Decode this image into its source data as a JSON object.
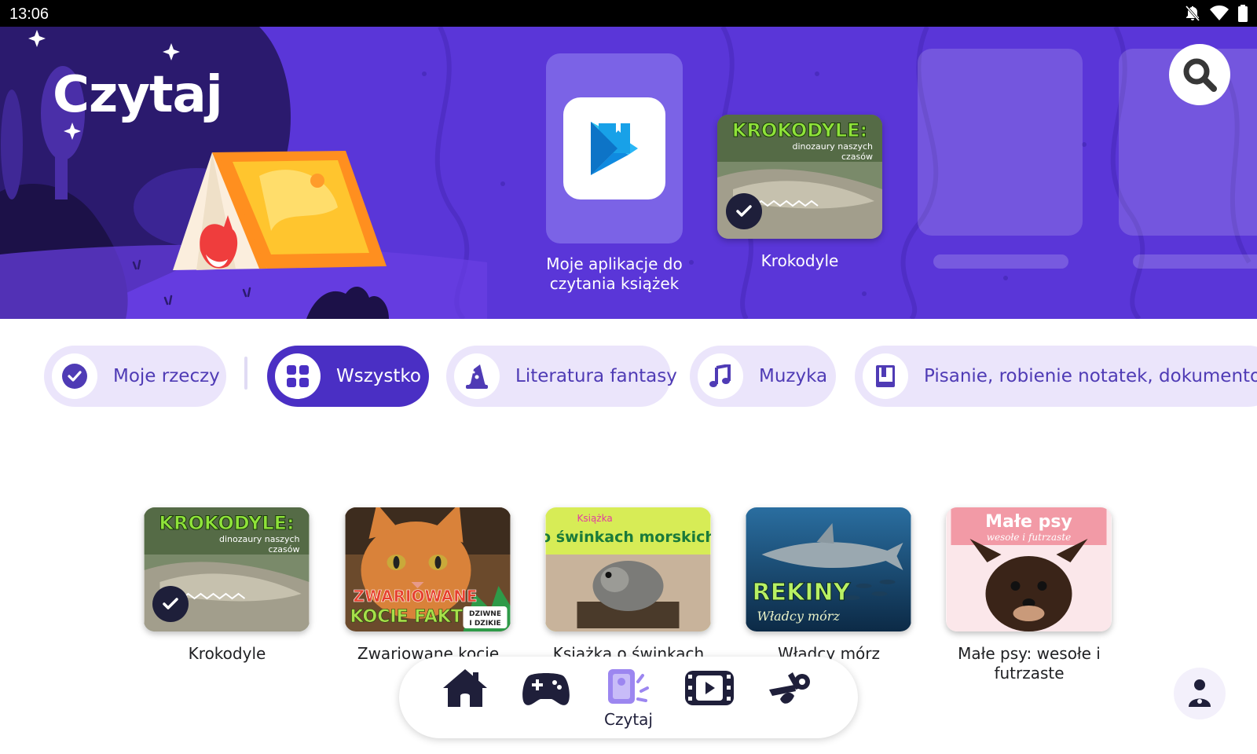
{
  "status_bar": {
    "time": "13:06"
  },
  "header": {
    "title": "Czytaj"
  },
  "featured": [
    {
      "label": "Moje aplikacje do czytania książek"
    },
    {
      "label": "Krokodyle"
    }
  ],
  "thumb_texts": {
    "krokodyle_title": "KROKODYLE:",
    "krokodyle_sub1": "dinozaury naszych",
    "krokodyle_sub2": "czasów",
    "kocie_line1": "ZWARIOWANE",
    "kocie_line2": "KOCIE FAKTY",
    "kocie_badge1": "DZIWNE",
    "kocie_badge2": "I DZIKIE",
    "swinki_top": "Książka",
    "swinki_main": "o świnkach morskich",
    "rekiny_title": "REKINY",
    "rekiny_sub": "Władcy mórz",
    "psy_title": "Małe psy",
    "psy_sub": "wesołe i futrzaste"
  },
  "chips": [
    {
      "label": "Moje rzeczy",
      "icon": "check-circle-icon",
      "active": false
    },
    {
      "label": "Wszystko",
      "icon": "grid-icon",
      "active": true
    },
    {
      "label": "Literatura fantasy",
      "icon": "wizard-hat-icon",
      "active": false
    },
    {
      "label": "Muzyka",
      "icon": "music-note-icon",
      "active": false
    },
    {
      "label": "Pisanie, robienie notatek, dokumentowanie",
      "icon": "notebook-icon",
      "active": false
    }
  ],
  "books": [
    {
      "label": "Krokodyle"
    },
    {
      "label": "Zwariowane kocie"
    },
    {
      "label": "Książka o świnkach"
    },
    {
      "label": "Władcy mórz"
    },
    {
      "label": "Małe psy: wesołe i futrzaste"
    }
  ],
  "bottom_nav": [
    {
      "icon": "house-icon",
      "label": ""
    },
    {
      "icon": "gamepad-icon",
      "label": ""
    },
    {
      "icon": "read-icon",
      "label": "Czytaj",
      "active": true
    },
    {
      "icon": "video-icon",
      "label": ""
    },
    {
      "icon": "create-icon",
      "label": ""
    }
  ],
  "colors": {
    "hero": "#5a36d8",
    "chip_active": "#4a2fc4",
    "chip_bg": "#ebe5fb",
    "accent": "#4f3bb5"
  }
}
